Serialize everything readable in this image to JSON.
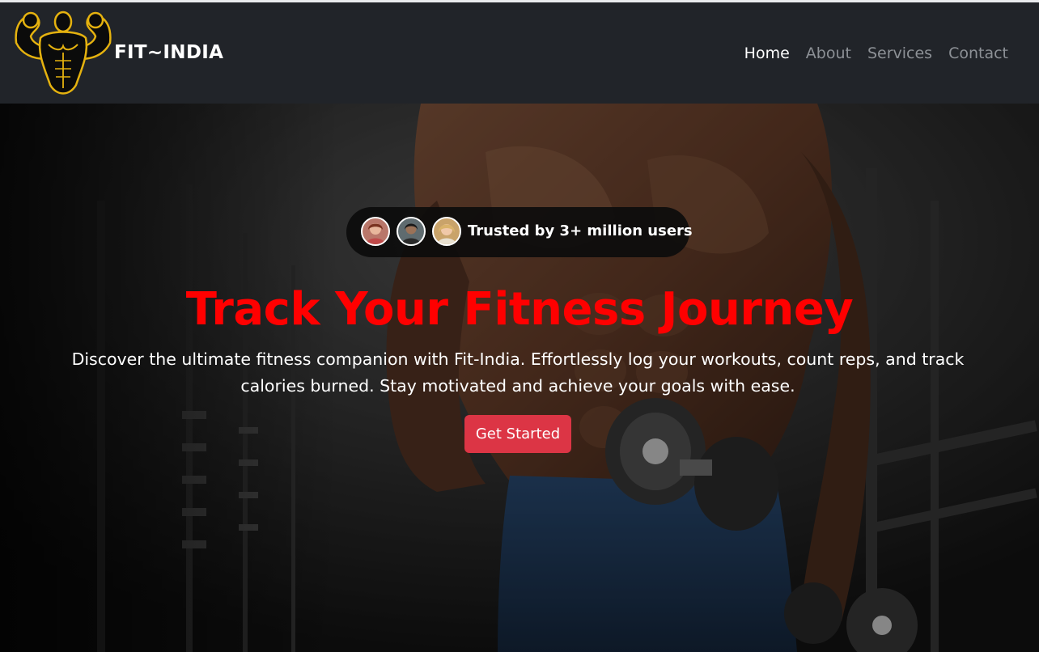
{
  "navbar": {
    "brand": "FIT~INDIA",
    "logo_icon": "muscleman-logo-icon",
    "links": [
      {
        "label": "Home",
        "active": true
      },
      {
        "label": "About",
        "active": false
      },
      {
        "label": "Services",
        "active": false
      },
      {
        "label": "Contact",
        "active": false
      }
    ]
  },
  "hero": {
    "trust_text": "Trusted by 3+ million users",
    "avatars": [
      "user-avatar-1",
      "user-avatar-2",
      "user-avatar-3"
    ],
    "headline": "Track Your Fitness Journey",
    "description": "Discover the ultimate fitness companion with Fit-India. Effortlessly log your workouts, count reps, and track calories burned. Stay motivated and achieve your goals with ease.",
    "cta_label": "Get Started"
  },
  "colors": {
    "navbar_bg": "#212429",
    "headline": "#ff0000",
    "cta": "#dc3545",
    "logo_gold": "#e5b20f"
  }
}
